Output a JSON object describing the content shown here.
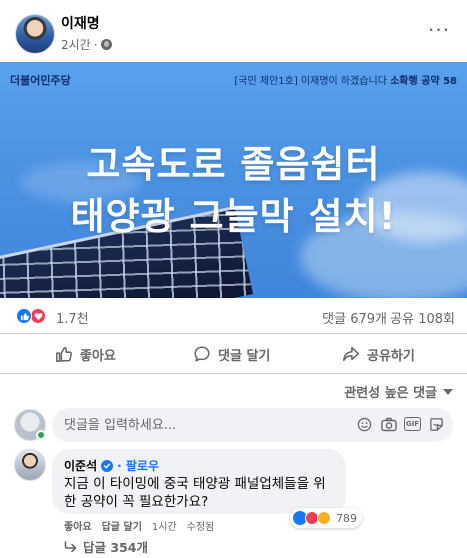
{
  "post": {
    "author": "이재명",
    "time": "2시간",
    "more_label": "···"
  },
  "banner": {
    "party": "더불어민주당",
    "pledge_prefix": "[국민 제안1호] 이재명이 하겠습니다",
    "pledge_name": "소확행 공약 58",
    "headline_line1": "고속도로 졸음쉼터",
    "headline_line2": "태양광 그늘막 설치!"
  },
  "stats": {
    "reactions": "1.7천",
    "comments": "댓글 679개",
    "shares": "공유 108회"
  },
  "actions": {
    "like": "좋아요",
    "comment": "댓글 달기",
    "share": "공유하기"
  },
  "sort": {
    "label": "관련성 높은 댓글"
  },
  "comment_input": {
    "placeholder": "댓글을 입력하세요..."
  },
  "comment": {
    "name": "이준석",
    "follow": "· 팔로우",
    "text": "지금 이 타이밍에 중국 태양광 패널업체들을 위한 공약이 꼭 필요한가요?",
    "reaction_count": "789",
    "like_link": "좋아요",
    "reply_link": "답글 달기",
    "time": "1시간",
    "edited": "수정됨",
    "replies": "답글 354개"
  },
  "colors": {
    "brand_blue": "#1877f2",
    "love_red": "#f33e58",
    "secondary_text": "#65676b",
    "banner_sky": "#4b92e3"
  },
  "icons": [
    "globe-icon",
    "more-icon",
    "like-icon",
    "love-icon",
    "comment-icon",
    "share-icon",
    "caret-down-icon",
    "emoji-icon",
    "camera-icon",
    "gif-icon",
    "sticker-icon",
    "verified-icon",
    "reply-arrow-icon"
  ]
}
